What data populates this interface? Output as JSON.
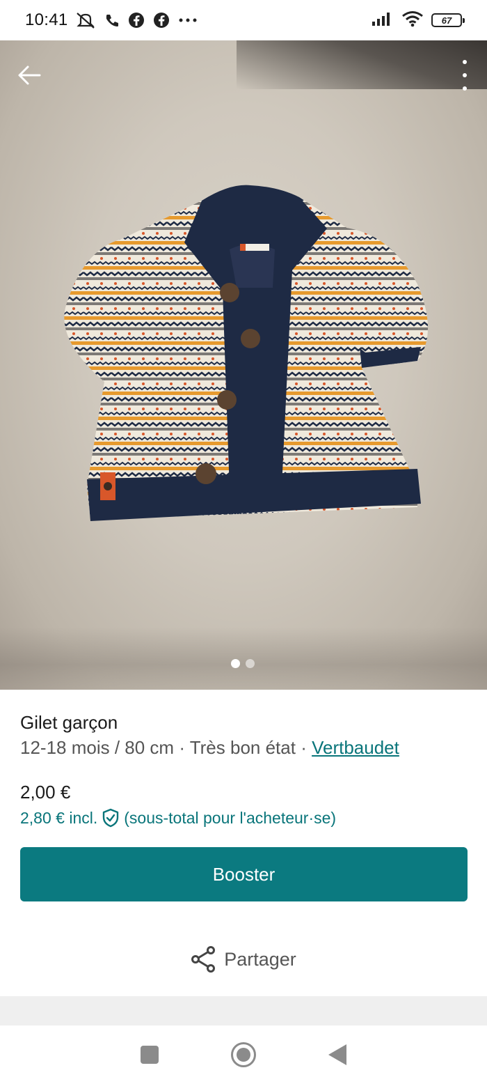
{
  "status_bar": {
    "time": "10:41",
    "left_icons": [
      "mute-icon",
      "phone-icon",
      "facebook-icon",
      "facebook-icon",
      "more-notifications-icon"
    ],
    "battery": "67"
  },
  "photo": {
    "pager_count": 2,
    "pager_active": 1
  },
  "item": {
    "title": "Gilet garçon",
    "size": "12-18 mois / 80 cm",
    "sep1": " · ",
    "condition": "Très bon état",
    "sep2": " · ",
    "brand": "Vertbaudet"
  },
  "pricing": {
    "price": "2,00 €",
    "incl_price": "2,80 € incl.",
    "incl_note": "(sous-total pour l'acheteur·se)"
  },
  "actions": {
    "booster_label": "Booster",
    "share_label": "Partager"
  },
  "colors": {
    "accent": "#0b7a80",
    "link": "#09757a"
  }
}
